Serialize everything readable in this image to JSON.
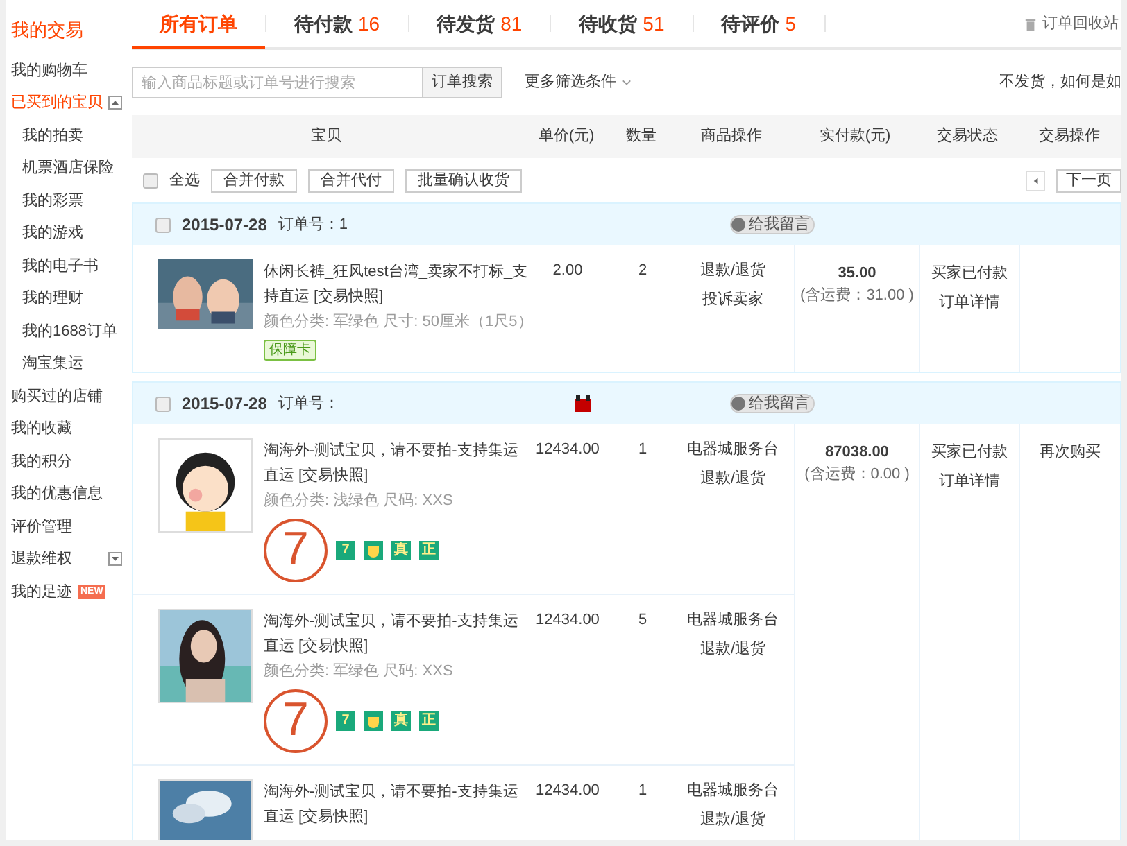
{
  "sidebar": {
    "title": "我的交易",
    "items": [
      {
        "label": "我的购物车",
        "selected": false
      },
      {
        "label": "已买到的宝贝",
        "selected": true,
        "expanded": true,
        "children": [
          {
            "label": "我的拍卖"
          },
          {
            "label": "机票酒店保险"
          },
          {
            "label": "我的彩票"
          },
          {
            "label": "我的游戏"
          },
          {
            "label": "我的电子书"
          },
          {
            "label": "我的理财"
          },
          {
            "label": "我的1688订单"
          },
          {
            "label": "淘宝集运"
          }
        ]
      },
      {
        "label": "购买过的店铺",
        "selected": false
      },
      {
        "label": "我的收藏",
        "selected": false
      },
      {
        "label": "我的积分",
        "selected": false
      },
      {
        "label": "我的优惠信息",
        "selected": false
      },
      {
        "label": "评价管理",
        "selected": false
      },
      {
        "label": "退款维权",
        "selected": false,
        "expanded": false
      },
      {
        "label": "我的足迹",
        "selected": false,
        "badge": "NEW"
      }
    ]
  },
  "tabs": [
    {
      "label": "所有订单",
      "selected": true
    },
    {
      "label": "待付款",
      "count": "16",
      "selected": false
    },
    {
      "label": "待发货",
      "count": "81",
      "selected": false
    },
    {
      "label": "待收货",
      "count": "51",
      "selected": false
    },
    {
      "label": "待评价",
      "count": "5",
      "selected": false
    }
  ],
  "recycle_bin": "订单回收站",
  "search": {
    "placeholder": "输入商品标题或订单号进行搜索",
    "button": "订单搜索",
    "more_filters": "更多筛选条件",
    "notice": "不发货，如何是如"
  },
  "table": {
    "columns": [
      "宝贝",
      "单价(元)",
      "数量",
      "商品操作",
      "实付款(元)",
      "交易状态",
      "交易操作"
    ]
  },
  "toolbar": {
    "select_all": {
      "label": "全选",
      "checked": false
    },
    "buttons": [
      "合并付款",
      "合并代付",
      "批量确认收货"
    ],
    "next_page": "下一页"
  },
  "orders": [
    {
      "date": "2015-07-28",
      "order_label": "订单号：",
      "order_no": "1",
      "message": "给我留言",
      "checked": false,
      "items": [
        {
          "title": "休闲长裤_狂风test台湾_卖家不打标_支持直运 [交易快照]",
          "attributes": "颜色分类: 军绿色 尺寸: 50厘米（1尺5）",
          "price": "2.00",
          "quantity": "2",
          "operations": [
            "退款/退货",
            "投诉卖家"
          ],
          "insurance": "保障卡",
          "kind": "picture"
        }
      ],
      "total": "35.00",
      "shipping": "(含运费：31.00 )",
      "status": [
        "买家已付款",
        "订单详情"
      ]
    },
    {
      "date": "2015-07-28",
      "order_label": "订单号：",
      "shop_icon": true,
      "message": "给我留言",
      "checked": false,
      "items": [
        {
          "title": "淘海外-测试宝贝，请不要拍-支持集运直运 [交易快照]",
          "attributes": "颜色分类: 浅绿色 尺码: XXS",
          "price": "12434.00",
          "quantity": "1",
          "operations": [
            "电器城服务台",
            "退款/退货"
          ],
          "seven_day": "7",
          "tags": [
            {
              "kind": "text",
              "text": "7"
            },
            {
              "kind": "icon"
            },
            {
              "kind": "text",
              "text": "真"
            },
            {
              "kind": "text",
              "text": "正"
            }
          ],
          "kind": "picture"
        },
        {
          "title": "淘海外-测试宝贝，请不要拍-支持集运直运 [交易快照]",
          "attributes": "颜色分类: 军绿色 尺码: XXS",
          "price": "12434.00",
          "quantity": "5",
          "operations": [
            "电器城服务台",
            "退款/退货"
          ],
          "seven_day": "7",
          "tags": [
            {
              "kind": "text",
              "text": "7"
            },
            {
              "kind": "icon"
            },
            {
              "kind": "text",
              "text": "真"
            },
            {
              "kind": "text",
              "text": "正"
            }
          ],
          "kind": "picture"
        },
        {
          "title": "淘海外-测试宝贝，请不要拍-支持集运直运 [交易快照]",
          "price": "12434.00",
          "quantity": "1",
          "operations": [
            "电器城服务台",
            "退款/退货"
          ],
          "kind": "picture"
        }
      ],
      "total": "87038.00",
      "shipping": "(含运费：0.00 )",
      "status": [
        "买家已付款",
        "订单详情"
      ],
      "actions": [
        "再次购买"
      ]
    }
  ]
}
